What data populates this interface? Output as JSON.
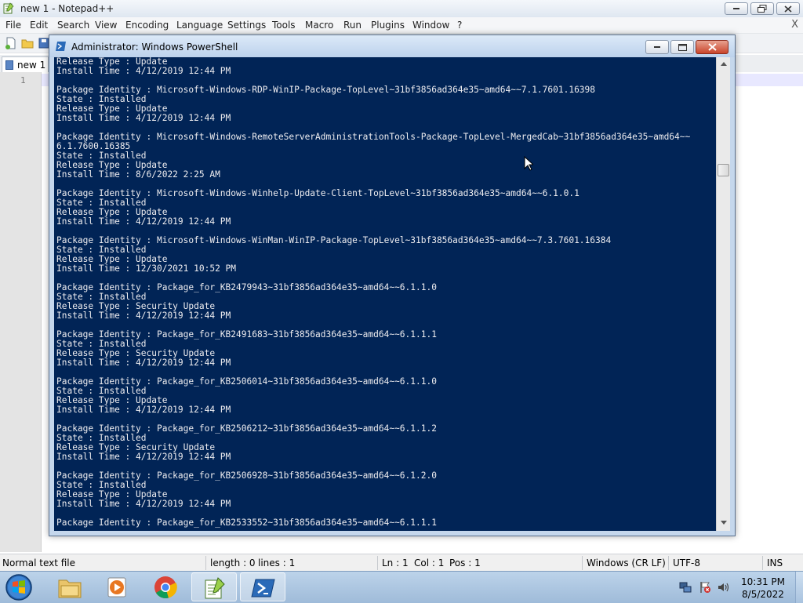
{
  "notepad": {
    "title": "new 1 - Notepad++",
    "menu": [
      "File",
      "Edit",
      "Search",
      "View",
      "Encoding",
      "Language",
      "Settings",
      "Tools",
      "Macro",
      "Run",
      "Plugins",
      "Window",
      "?"
    ],
    "menu_close": "X",
    "tab_label": "new 1",
    "line_number": "1",
    "status": {
      "file_type": "Normal text file",
      "length": "length : 0",
      "lines": "lines : 1",
      "ln": "Ln : 1",
      "col": "Col : 1",
      "pos": "Pos : 1",
      "eol": "Windows (CR LF)",
      "encoding": "UTF-8",
      "mode": "INS"
    }
  },
  "powershell": {
    "title": "Administrator: Windows PowerShell",
    "output": "Release Type : Update\nInstall Time : 4/12/2019 12:44 PM\n\nPackage Identity : Microsoft-Windows-RDP-WinIP-Package-TopLevel~31bf3856ad364e35~amd64~~7.1.7601.16398\nState : Installed\nRelease Type : Update\nInstall Time : 4/12/2019 12:44 PM\n\nPackage Identity : Microsoft-Windows-RemoteServerAdministrationTools-Package-TopLevel-MergedCab~31bf3856ad364e35~amd64~~\n6.1.7600.16385\nState : Installed\nRelease Type : Update\nInstall Time : 8/6/2022 2:25 AM\n\nPackage Identity : Microsoft-Windows-Winhelp-Update-Client-TopLevel~31bf3856ad364e35~amd64~~6.1.0.1\nState : Installed\nRelease Type : Update\nInstall Time : 4/12/2019 12:44 PM\n\nPackage Identity : Microsoft-Windows-WinMan-WinIP-Package-TopLevel~31bf3856ad364e35~amd64~~7.3.7601.16384\nState : Installed\nRelease Type : Update\nInstall Time : 12/30/2021 10:52 PM\n\nPackage Identity : Package_for_KB2479943~31bf3856ad364e35~amd64~~6.1.1.0\nState : Installed\nRelease Type : Security Update\nInstall Time : 4/12/2019 12:44 PM\n\nPackage Identity : Package_for_KB2491683~31bf3856ad364e35~amd64~~6.1.1.1\nState : Installed\nRelease Type : Security Update\nInstall Time : 4/12/2019 12:44 PM\n\nPackage Identity : Package_for_KB2506014~31bf3856ad364e35~amd64~~6.1.1.0\nState : Installed\nRelease Type : Update\nInstall Time : 4/12/2019 12:44 PM\n\nPackage Identity : Package_for_KB2506212~31bf3856ad364e35~amd64~~6.1.1.2\nState : Installed\nRelease Type : Security Update\nInstall Time : 4/12/2019 12:44 PM\n\nPackage Identity : Package_for_KB2506928~31bf3856ad364e35~amd64~~6.1.2.0\nState : Installed\nRelease Type : Update\nInstall Time : 4/12/2019 12:44 PM\n\nPackage Identity : Package_for_KB2533552~31bf3856ad364e35~amd64~~6.1.1.1",
    "console_bg": "#012456",
    "console_fg": "#eeedf0"
  },
  "taskbar": {
    "apps": [
      "windows-explorer-icon",
      "media-player-icon",
      "chrome-icon",
      "notepad-plus-plus-icon",
      "powershell-icon"
    ],
    "tray_icons": [
      "network-icon",
      "action-center-flag-icon",
      "volume-icon"
    ],
    "clock": {
      "time": "10:31 PM",
      "date": "8/5/2022"
    }
  }
}
